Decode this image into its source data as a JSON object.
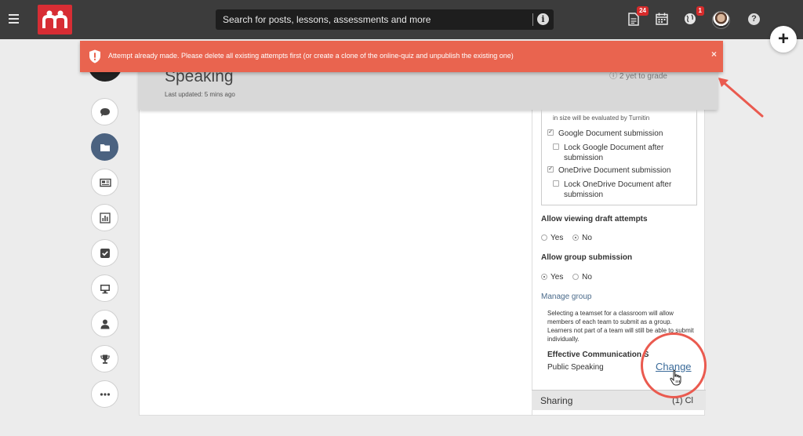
{
  "topbar": {
    "search_placeholder": "Search for posts, lessons, assessments and more",
    "notifications_badge": "24",
    "alerts_badge": "1",
    "colors": {
      "bar": "#3c3c3c",
      "logo": "#d72d34",
      "badge": "#d62b2b"
    }
  },
  "header": {
    "title": "Speaking",
    "last_updated": "Last updated: 5 mins ago",
    "to_grade": "ⓘ 2 yet to grade"
  },
  "settings": {
    "turnitin_note": "in size will be evaluated by Turnitin",
    "google_doc": "Google Document submission",
    "lock_google": "Lock Google Document after submission",
    "onedrive": "OneDrive Document submission",
    "lock_onedrive": "Lock OneDrive Document after submission",
    "draft_label": "Allow viewing draft attempts",
    "yes": "Yes",
    "no": "No",
    "group_label": "Allow group submission",
    "manage_group": "Manage group",
    "group_desc": "Selecting a teamset for a classroom will allow members of each team to submit as a group. Learners not part of a team will still be able to submit individually.",
    "eff_comm": "Effective Communication S",
    "public_speaking": "Public Speaking",
    "change": "Change"
  },
  "sharing": {
    "label": "Sharing",
    "count": "(1) Cl"
  },
  "error": {
    "message": "Attempt already made. Please delete all existing attempts first (or create a clone of the online-quiz and unpublish the existing one)",
    "close": "×",
    "color": "#e9644f"
  },
  "sidebar_icons": [
    "comment-icon",
    "folder-icon",
    "newspaper-icon",
    "chart-icon",
    "check-icon",
    "monitor-icon",
    "user-icon",
    "trophy-icon",
    "more-icon"
  ]
}
